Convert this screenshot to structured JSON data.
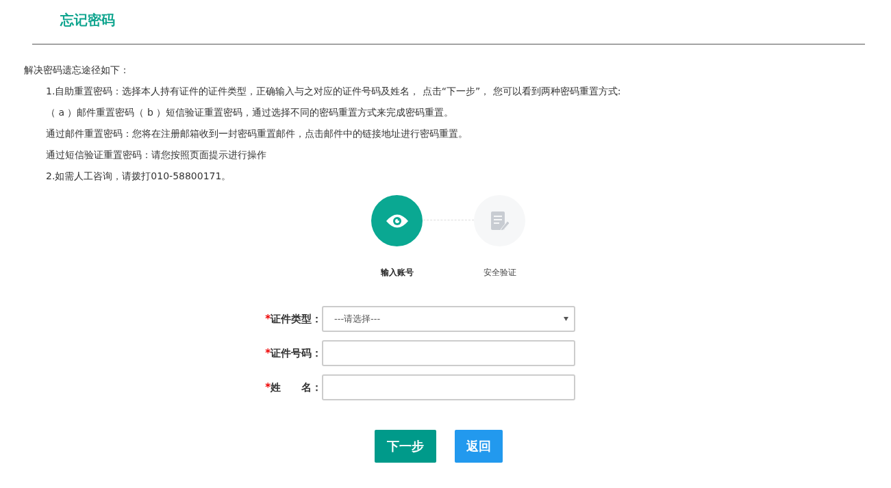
{
  "title": "忘记密码",
  "intro": {
    "heading": "解决密码遗忘途径如下：",
    "lines": [
      "1.自助重置密码：选择本人持有证件的证件类型，正确输入与之对应的证件号码及姓名， 点击“下一步”， 您可以看到两种密码重置方式:",
      "（ a ）邮件重置密码（ b ）短信验证重置密码，通过选择不同的密码重置方式来完成密码重置。",
      "通过邮件重置密码：您将在注册邮箱收到一封密码重置邮件，点击邮件中的链接地址进行密码重置。",
      "通过短信验证重置密码：请您按照页面提示进行操作",
      "2.如需人工咨询，请拨打010-58800171。"
    ]
  },
  "steps": [
    {
      "label": "输入账号",
      "selected": true,
      "kind": "eye"
    },
    {
      "label": "安全验证",
      "selected": false,
      "kind": "document"
    }
  ],
  "form": {
    "fields": [
      {
        "kind": "select",
        "required_mark": "*",
        "label": "证件类型：",
        "value": "---请选择---"
      },
      {
        "kind": "text",
        "required_mark": "*",
        "label": "证件号码："
      },
      {
        "kind": "text",
        "required_mark": "*",
        "label": "姓　　名："
      }
    ]
  },
  "buttons": [
    {
      "label": "下一步",
      "kind": "primary"
    },
    {
      "label": "返回",
      "kind": "secondary"
    }
  ]
}
